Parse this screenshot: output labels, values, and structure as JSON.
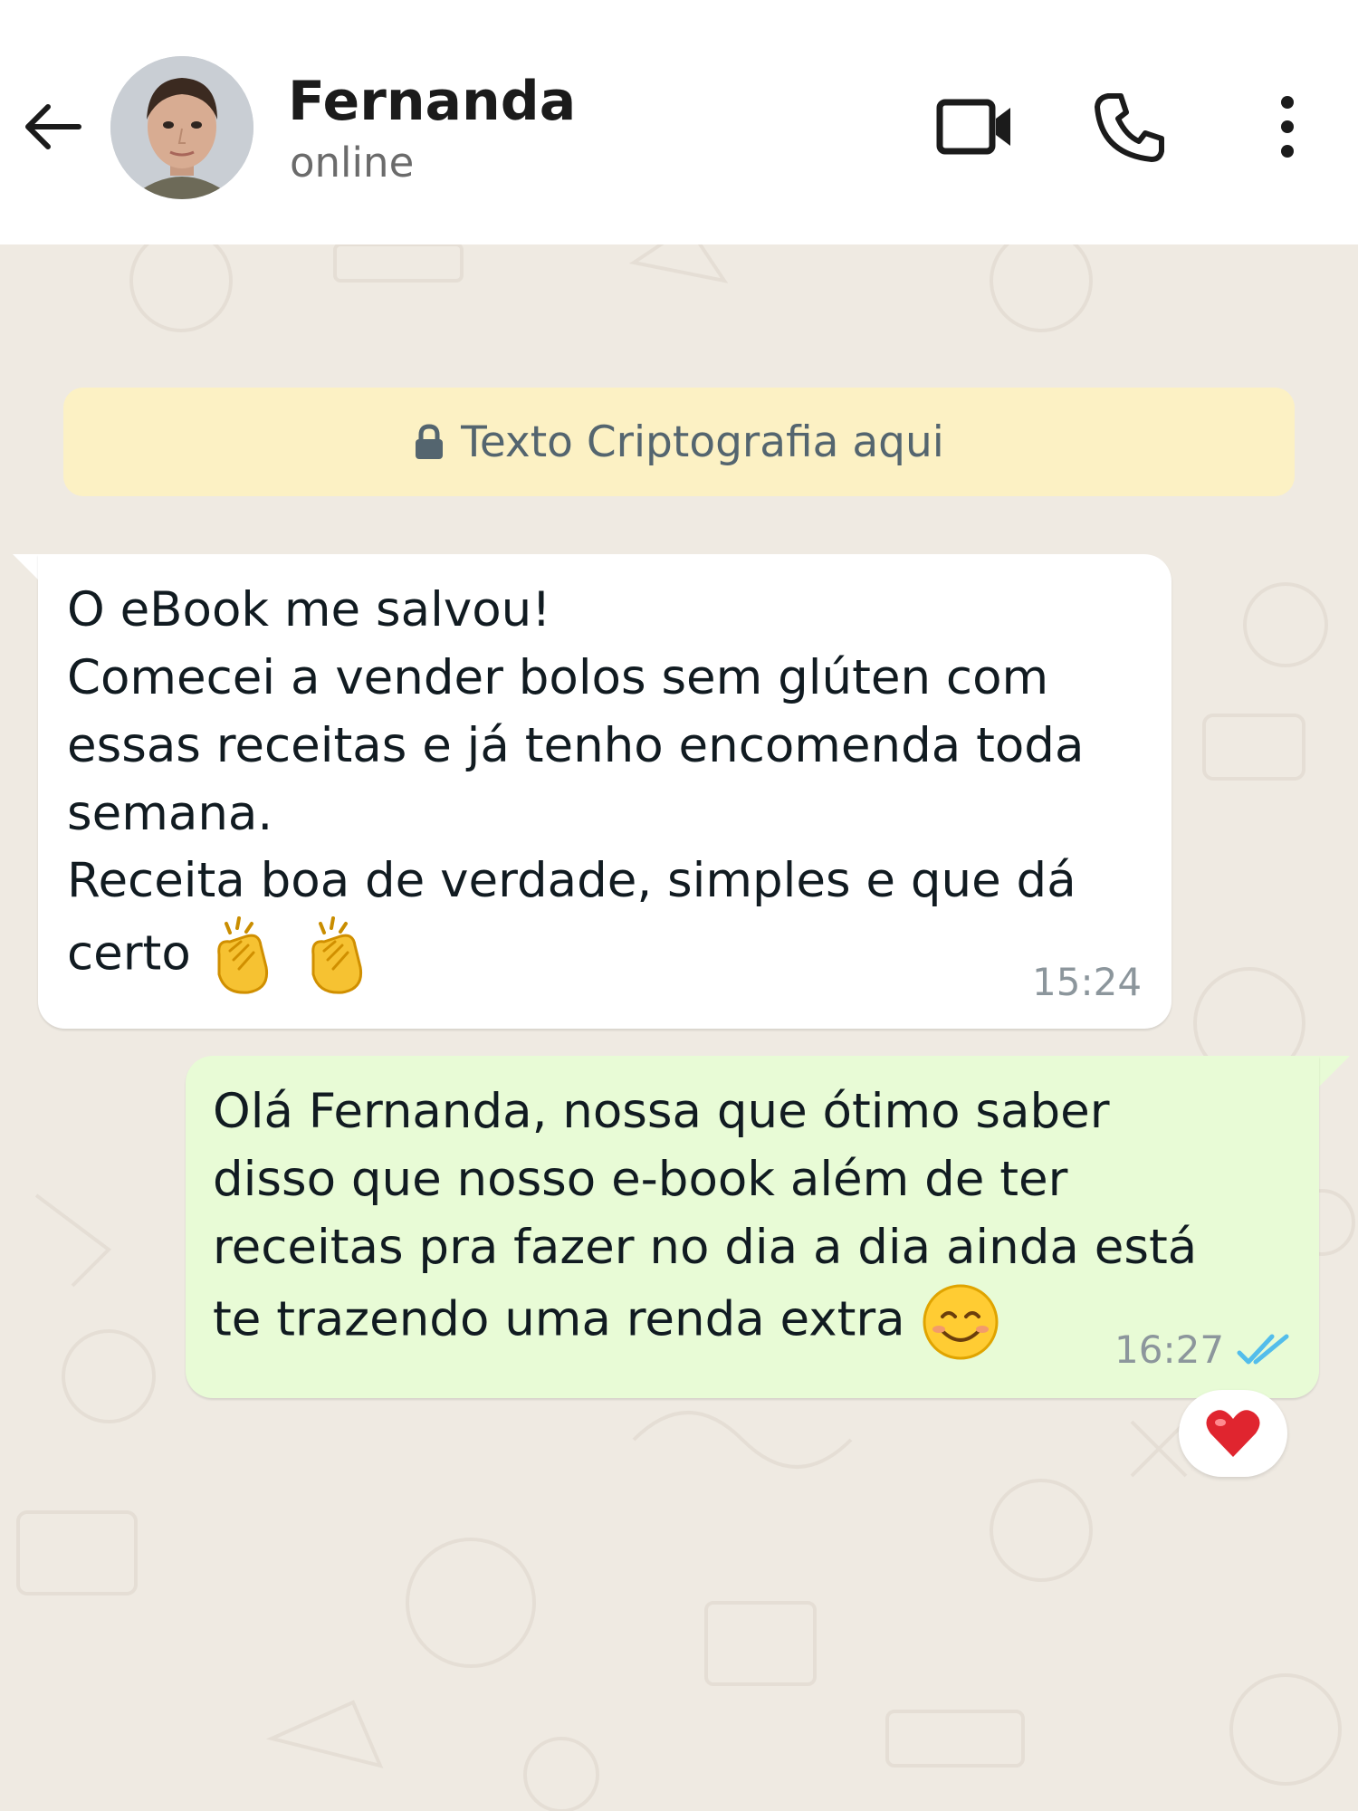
{
  "header": {
    "contact_name": "Fernanda",
    "contact_status": "online",
    "icons": [
      "back-arrow-icon",
      "video-call-icon",
      "phone-icon",
      "more-options-icon"
    ]
  },
  "encryption_banner": {
    "text": "Texto Criptografia aqui",
    "icon": "lock-icon"
  },
  "messages": [
    {
      "direction": "incoming",
      "lines": [
        "O eBook me salvou!",
        "Comecei a vender bolos sem glúten com",
        "essas receitas e já tenho encomenda toda",
        "semana.",
        "Receita boa de verdade, simples e que dá",
        "certo"
      ],
      "trailing_emoji": [
        "clapping-hands-emoji",
        "clapping-hands-emoji"
      ],
      "time": "15:24"
    },
    {
      "direction": "outgoing",
      "lines": [
        "Olá Fernanda, nossa que ótimo saber",
        "disso que nosso e-book além de ter",
        "receitas pra fazer no dia a dia ainda está",
        "te trazendo uma renda extra"
      ],
      "trailing_emoji": [
        "smiling-face-emoji"
      ],
      "time": "16:27",
      "status": "read",
      "reaction": "red-heart-emoji"
    }
  ],
  "colors": {
    "wallpaper": "#efeae2",
    "incoming_bubble": "#ffffff",
    "outgoing_bubble": "#e8fbd6",
    "banner": "#fcf1c4",
    "read_ticks": "#53bdeb",
    "timestamp": "#8c969c"
  }
}
